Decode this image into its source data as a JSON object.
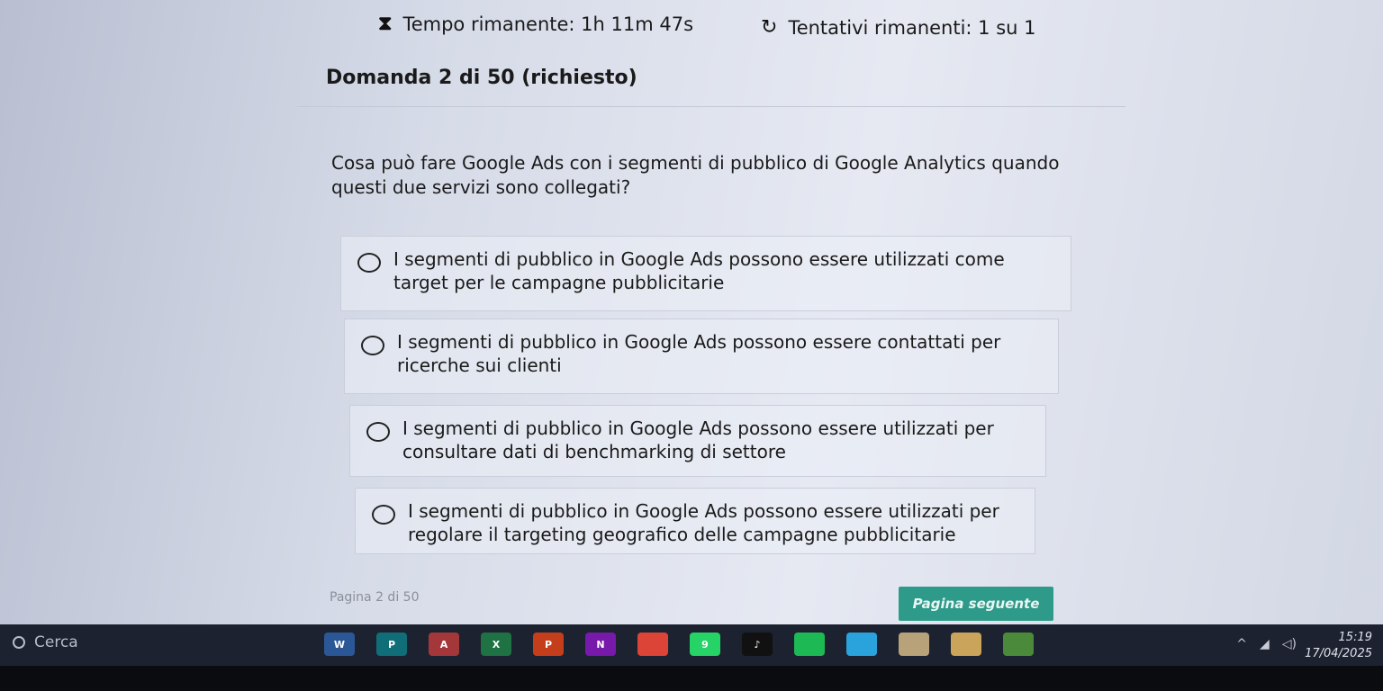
{
  "header": {
    "timer_label": "Tempo rimanente: 1h 11m 47s",
    "attempts_label": "Tentativi rimanenti: 1 su 1",
    "timer_icon": "hourglass-icon",
    "attempts_icon": "refresh-icon"
  },
  "question": {
    "title": "Domanda 2 di 50 (richiesto)",
    "text": "Cosa può fare Google Ads con i segmenti di pubblico di Google Analytics quando questi due servizi sono collegati?",
    "options": [
      {
        "label": "I segmenti di pubblico in Google Ads possono essere utilizzati come target per le campagne pubblicitarie"
      },
      {
        "label": "I segmenti di pubblico in Google Ads possono essere contattati per ricerche sui clienti"
      },
      {
        "label": "I segmenti di pubblico in Google Ads possono essere utilizzati per consultare dati di benchmarking di settore"
      },
      {
        "label": "I segmenti di pubblico in Google Ads possono essere utilizzati per regolare il targeting geografico delle campagne pubblicitarie"
      }
    ]
  },
  "footer": {
    "page_info": "Pagina 2 di 50",
    "next_label": "Pagina seguente"
  },
  "taskbar": {
    "search_placeholder": "Cerca",
    "apps": [
      {
        "name": "word",
        "glyph": "W",
        "color": "#2b5797"
      },
      {
        "name": "powerpoint-teal",
        "glyph": "P",
        "color": "#0f6e78"
      },
      {
        "name": "access",
        "glyph": "A",
        "color": "#a4373a"
      },
      {
        "name": "excel",
        "glyph": "X",
        "color": "#1f7244"
      },
      {
        "name": "powerpoint",
        "glyph": "P",
        "color": "#c43e1c"
      },
      {
        "name": "onenote",
        "glyph": "N",
        "color": "#7719aa"
      },
      {
        "name": "chrome",
        "glyph": "",
        "color": "#db4437"
      },
      {
        "name": "whatsapp",
        "glyph": "9",
        "color": "#25d366"
      },
      {
        "name": "tiktok",
        "glyph": "♪",
        "color": "#111111"
      },
      {
        "name": "spotify",
        "glyph": "",
        "color": "#1db954"
      },
      {
        "name": "telegram",
        "glyph": "",
        "color": "#2aa3dd"
      },
      {
        "name": "game-1",
        "glyph": "",
        "color": "#b7a27a"
      },
      {
        "name": "game-2",
        "glyph": "",
        "color": "#c9a45a"
      },
      {
        "name": "game-3",
        "glyph": "",
        "color": "#4b8a3a"
      }
    ],
    "time": "15:19",
    "date": "17/04/2025"
  },
  "colors": {
    "accent": "#2e9a8a",
    "taskbar": "#1d2230"
  }
}
